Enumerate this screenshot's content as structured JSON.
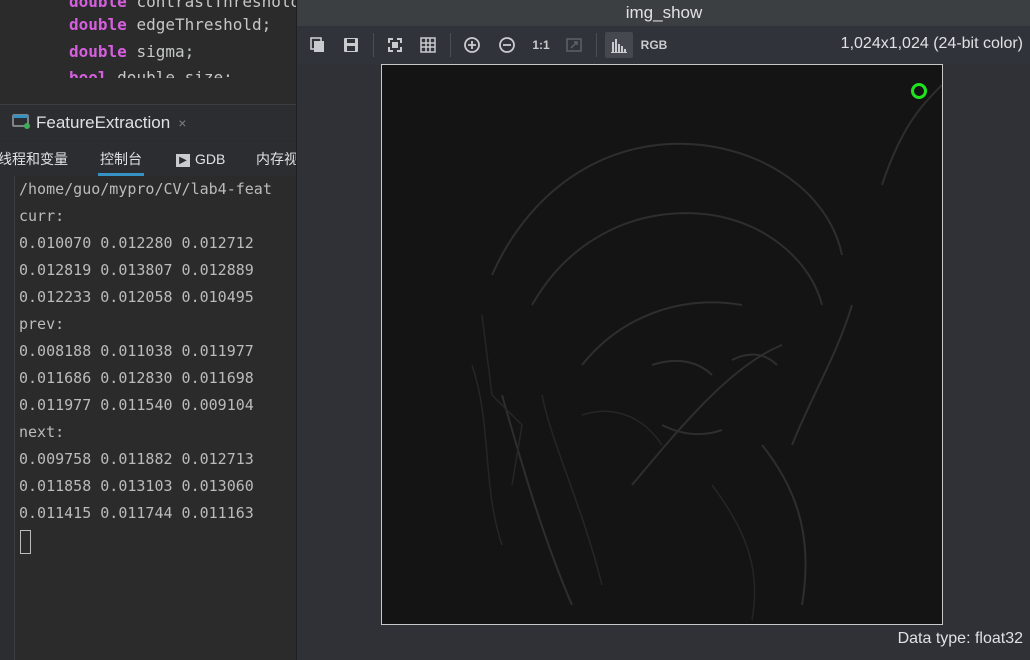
{
  "editor": {
    "lines": [
      {
        "type": "double",
        "name": "contrastThreshold;"
      },
      {
        "type": "double",
        "name": "edgeThreshold;"
      },
      {
        "type": "double",
        "name": "sigma;"
      },
      {
        "type": "bool",
        "name": "double_size;"
      }
    ]
  },
  "run_panel": {
    "tab_label": "FeatureExtraction",
    "close_glyph": "×",
    "subtabs": [
      "线程和变量",
      "控制台",
      "GDB",
      "内存视图"
    ],
    "active_subtab": "控制台"
  },
  "console": {
    "lines": [
      "/home/guo/mypro/CV/lab4-feat",
      "curr:",
      "0.010070 0.012280 0.012712",
      "0.012819 0.013807 0.012889",
      "0.012233 0.012058 0.010495",
      "prev:",
      "0.008188 0.011038 0.011977",
      "0.011686 0.012830 0.011698",
      "0.011977 0.011540 0.009104",
      "next:",
      "0.009758 0.011882 0.012713",
      "0.011858 0.013103 0.013060",
      "0.011415 0.011744 0.011163"
    ]
  },
  "image_window": {
    "title": "img_show",
    "toolbar": {
      "copy": "copy-icon",
      "save": "save-icon",
      "fit": "fit-icon",
      "grid": "grid-icon",
      "zoom_in": "zoom-in-icon",
      "zoom_out": "zoom-out-icon",
      "one_to_one": "1:1",
      "expand": "expand-icon",
      "histogram": "histogram-icon",
      "rgb": "RGB"
    },
    "image_info": "1,024x1,024 (24-bit color)",
    "status": "Data type: float32",
    "marker_color": "#1fe51f"
  }
}
